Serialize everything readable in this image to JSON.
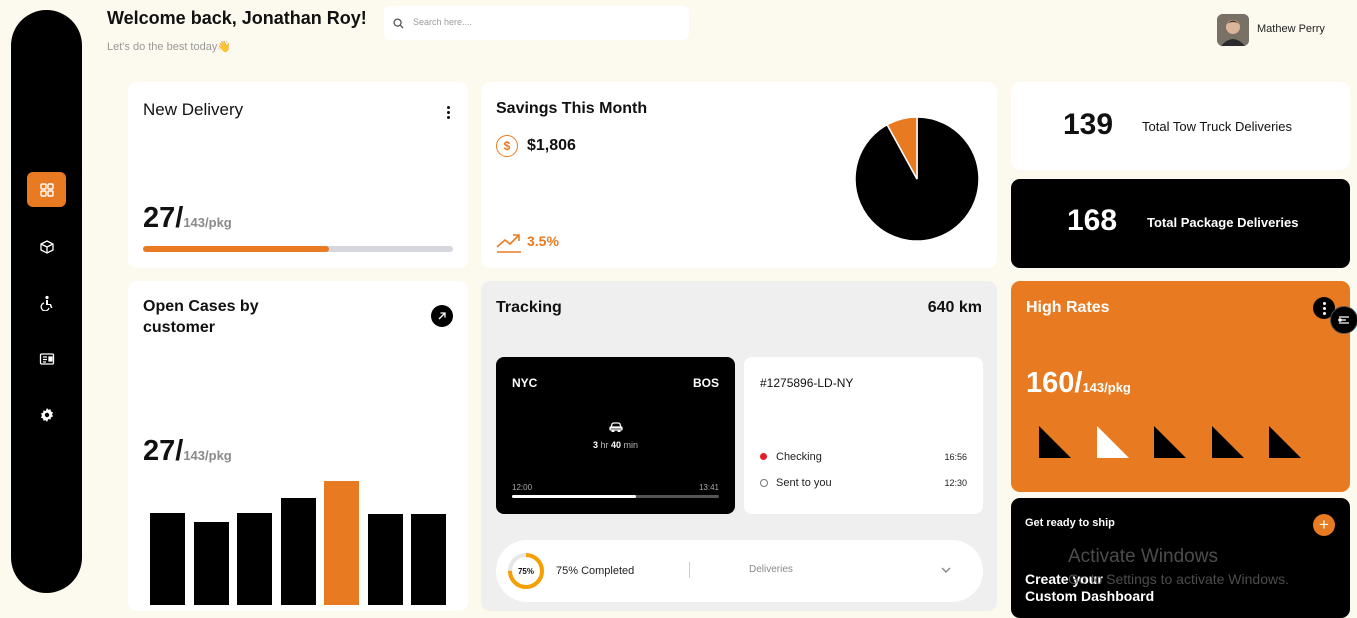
{
  "header": {
    "welcome": "Welcome back, Jonathan Roy!",
    "subtitle": "Let's do the best today",
    "subtitle_emoji": "👋",
    "search_placeholder": "Search here....",
    "user_name": "Mathew Perry"
  },
  "sidebar": {
    "items": [
      {
        "icon": "dashboard-grid-icon",
        "active": true
      },
      {
        "icon": "package-box-icon",
        "active": false
      },
      {
        "icon": "accessibility-icon",
        "active": false
      },
      {
        "icon": "id-card-icon",
        "active": false
      },
      {
        "icon": "settings-gear-icon",
        "active": false
      }
    ]
  },
  "new_delivery": {
    "title": "New Delivery",
    "value": "27/",
    "unit": "143/pkg",
    "progress": 0.6
  },
  "savings": {
    "title": "Savings This Month",
    "currency_symbol": "$",
    "amount": "$1,806",
    "change": "3.5%"
  },
  "chart_data": {
    "type": "pie",
    "slices": [
      {
        "label": "",
        "value": 92,
        "color": "#000000"
      },
      {
        "label": "",
        "value": 8,
        "color": "#e87b22"
      }
    ]
  },
  "stats": {
    "tow_value": "139",
    "tow_label": "Total Tow Truck Deliveries",
    "pkg_value": "168",
    "pkg_label": "Total Package Deliveries"
  },
  "open_cases": {
    "title_line1": "Open Cases by",
    "title_line2": "customer",
    "value": "27/",
    "unit": "143/pkg",
    "bars": [
      0.74,
      0.67,
      0.74,
      0.86,
      1.0,
      0.73,
      0.73
    ],
    "highlight_index": 4
  },
  "tracking": {
    "title": "Tracking",
    "distance": "640 km",
    "from": "NYC",
    "to": "BOS",
    "duration_h": "3",
    "hr_label": "hr",
    "duration_m": "40",
    "min_label": "min",
    "start_time": "12:00",
    "end_time": "13:41",
    "route_progress": 0.6,
    "shipment_id": "#1275896-LD-NY",
    "events": [
      {
        "label": "Checking",
        "time": "16:56",
        "status": "active"
      },
      {
        "label": "Sent to you",
        "time": "12:30",
        "status": "pending"
      }
    ],
    "completion_percent": "75%",
    "completion_label": "75% Completed",
    "completion_value": 0.75,
    "deliveries_label": "Deliveries"
  },
  "high_rates": {
    "title": "High Rates",
    "value": "160/",
    "unit": "143/pkg",
    "triangles": [
      "black",
      "white",
      "black",
      "black",
      "black"
    ]
  },
  "ship": {
    "title": "Get ready to ship",
    "custom_line1": "Create your",
    "custom_line2": "Custom Dashboard"
  },
  "watermark": {
    "line1": "Activate Windows",
    "line2": "Go to Settings to activate Windows."
  },
  "colors": {
    "accent": "#e87b22",
    "background": "#fcf9ee",
    "dark": "#000000"
  }
}
